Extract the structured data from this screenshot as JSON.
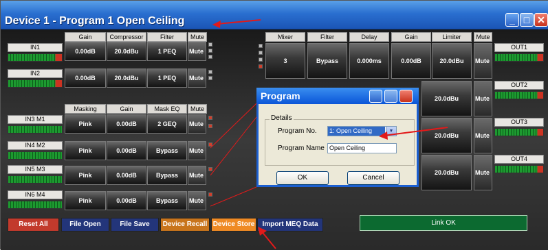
{
  "window": {
    "title": "Device 1  -  Program 1  Open Ceiling"
  },
  "input_headers": [
    "Gain",
    "Compressor",
    "Filter",
    "Mute"
  ],
  "inputs": [
    {
      "label": "IN1",
      "gain": "0.00dB",
      "comp": "20.0dBu",
      "filter": "1 PEQ",
      "mute": "Mute"
    },
    {
      "label": "IN2",
      "gain": "0.00dB",
      "comp": "20.0dBu",
      "filter": "1 PEQ",
      "mute": "Mute"
    }
  ],
  "mask_headers": [
    "Masking",
    "Gain",
    "Mask EQ",
    "Mute"
  ],
  "masks": [
    {
      "label": "IN3 M1",
      "masking": "Pink",
      "gain": "0.00dB",
      "eq": "2 GEQ",
      "mute": "Mute"
    },
    {
      "label": "IN4 M2",
      "masking": "Pink",
      "gain": "0.00dB",
      "eq": "Bypass",
      "mute": "Mute"
    },
    {
      "label": "IN5 M3",
      "masking": "Pink",
      "gain": "0.00dB",
      "eq": "Bypass",
      "mute": "Mute"
    },
    {
      "label": "IN6 M4",
      "masking": "Pink",
      "gain": "0.00dB",
      "eq": "Bypass",
      "mute": "Mute"
    }
  ],
  "output_headers": [
    "Mixer",
    "Filter",
    "Delay",
    "Gain",
    "Limiter",
    "Mute"
  ],
  "output_row1": {
    "mixer": "3",
    "filter": "Bypass",
    "delay": "0.000ms",
    "gain": "0.00dB",
    "limiter": "20.0dBu",
    "mute": "Mute"
  },
  "output_limiters": [
    "20.0dBu",
    "20.0dBu",
    "20.0dBu"
  ],
  "output_mute": "Mute",
  "outputs": [
    "OUT1",
    "OUT2",
    "OUT3",
    "OUT4"
  ],
  "buttons": {
    "reset": "Reset All",
    "open": "File Open",
    "save": "File Save",
    "recall": "Device Recall",
    "store": "Device Store",
    "import": "Import MEQ Data"
  },
  "status": {
    "link": "Link OK"
  },
  "dialog": {
    "title": "Program",
    "group": "Details",
    "program_no_label": "Program No.",
    "program_no": "1: Open Ceiling",
    "program_name_label": "Program Name",
    "program_name": "Open Ceiling",
    "ok": "OK",
    "cancel": "Cancel"
  },
  "colors": {
    "reset": "#c23a2c",
    "file": "#23357a",
    "recall": "#c8741c",
    "store": "#ef8a24",
    "import": "#23357a",
    "link": "#0c6a30",
    "arrow": "#e21a1a"
  }
}
